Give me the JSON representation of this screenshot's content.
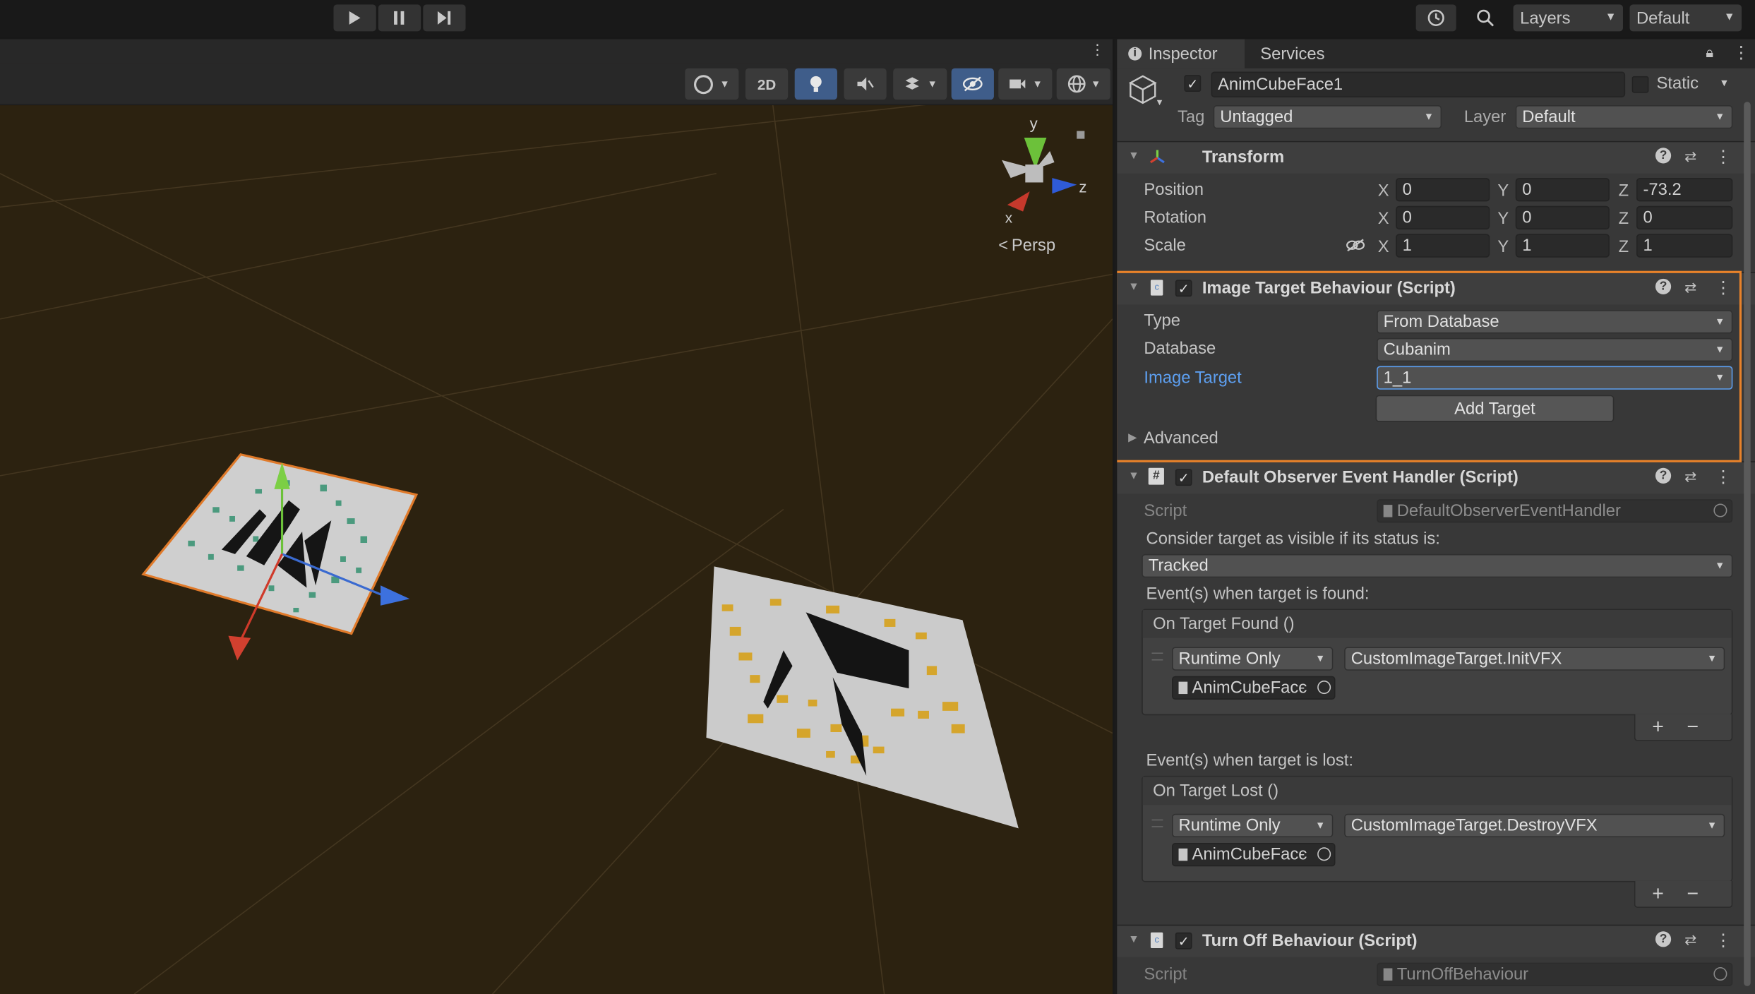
{
  "toolbar": {
    "play_icon": "play-icon",
    "pause_icon": "pause-icon",
    "step_icon": "step-icon",
    "layers_label": "Layers",
    "layout_label": "Default"
  },
  "scene": {
    "tool_2d": "2D",
    "gizmo_y": "y",
    "gizmo_z": "z",
    "gizmo_x": "x",
    "persp_label": "Persp",
    "background_color": "#2c2210"
  },
  "inspector": {
    "tabs": [
      "Inspector",
      "Services"
    ],
    "object": {
      "name": "AnimCubeFace1",
      "static_label": "Static",
      "tag_label": "Tag",
      "tag_value": "Untagged",
      "layer_label": "Layer",
      "layer_value": "Default"
    },
    "transform": {
      "title": "Transform",
      "position_label": "Position",
      "rotation_label": "Rotation",
      "scale_label": "Scale",
      "axis_x": "X",
      "axis_y": "Y",
      "axis_z": "Z",
      "position": [
        "0",
        "0",
        "-73.2"
      ],
      "rotation": [
        "0",
        "0",
        "0"
      ],
      "scale": [
        "1",
        "1",
        "1"
      ]
    },
    "image_target": {
      "title": "Image Target Behaviour (Script)",
      "type_label": "Type",
      "type_value": "From Database",
      "database_label": "Database",
      "database_value": "Cubanim",
      "image_target_label": "Image Target",
      "image_target_value": "1_1",
      "add_target_label": "Add Target",
      "advanced_label": "Advanced",
      "highlight_color": "#e8822a",
      "link_color": "#5d9ff0"
    },
    "observer": {
      "title": "Default Observer Event Handler (Script)",
      "script_label": "Script",
      "script_value": "DefaultObserverEventHandler",
      "visible_label": "Consider target as visible if its status is:",
      "status_value": "Tracked",
      "found_label": "Event(s) when target is found:",
      "found_header": "On Target Found ()",
      "found_mode": "Runtime Only",
      "found_function": "CustomImageTarget.InitVFX",
      "found_object": "AnimCubeFacє",
      "lost_label": "Event(s) when target is lost:",
      "lost_header": "On Target Lost ()",
      "lost_mode": "Runtime Only",
      "lost_function": "CustomImageTarget.DestroyVFX",
      "lost_object": "AnimCubeFacє",
      "plus": "+",
      "minus": "−"
    },
    "turnoff": {
      "title": "Turn Off Behaviour (Script)",
      "script_label": "Script",
      "script_value": "TurnOffBehaviour"
    }
  }
}
